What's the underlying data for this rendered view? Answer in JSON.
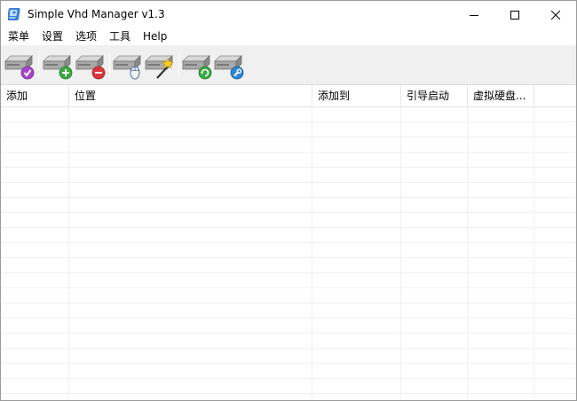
{
  "window": {
    "title": "Simple Vhd Manager v1.3",
    "icon": "app-disk-icon"
  },
  "menu": {
    "items": [
      "菜单",
      "设置",
      "选项",
      "工具",
      "Help"
    ]
  },
  "toolbar": {
    "buttons": [
      {
        "icon": "disk-check-icon"
      },
      {
        "icon": "disk-add-icon"
      },
      {
        "icon": "disk-remove-icon"
      },
      {
        "icon": "disk-mouse-icon"
      },
      {
        "icon": "disk-wand-icon"
      },
      {
        "icon": "disk-refresh-icon"
      },
      {
        "icon": "disk-tool-icon"
      }
    ]
  },
  "list": {
    "columns": [
      "添加",
      "位置",
      "添加到",
      "引导启动",
      "虚拟硬盘..."
    ],
    "rows": []
  },
  "colors": {
    "toolbar_bg": "#f0f0f0",
    "grid_line": "#f0f0f0",
    "header_line": "#e5e5e5"
  }
}
